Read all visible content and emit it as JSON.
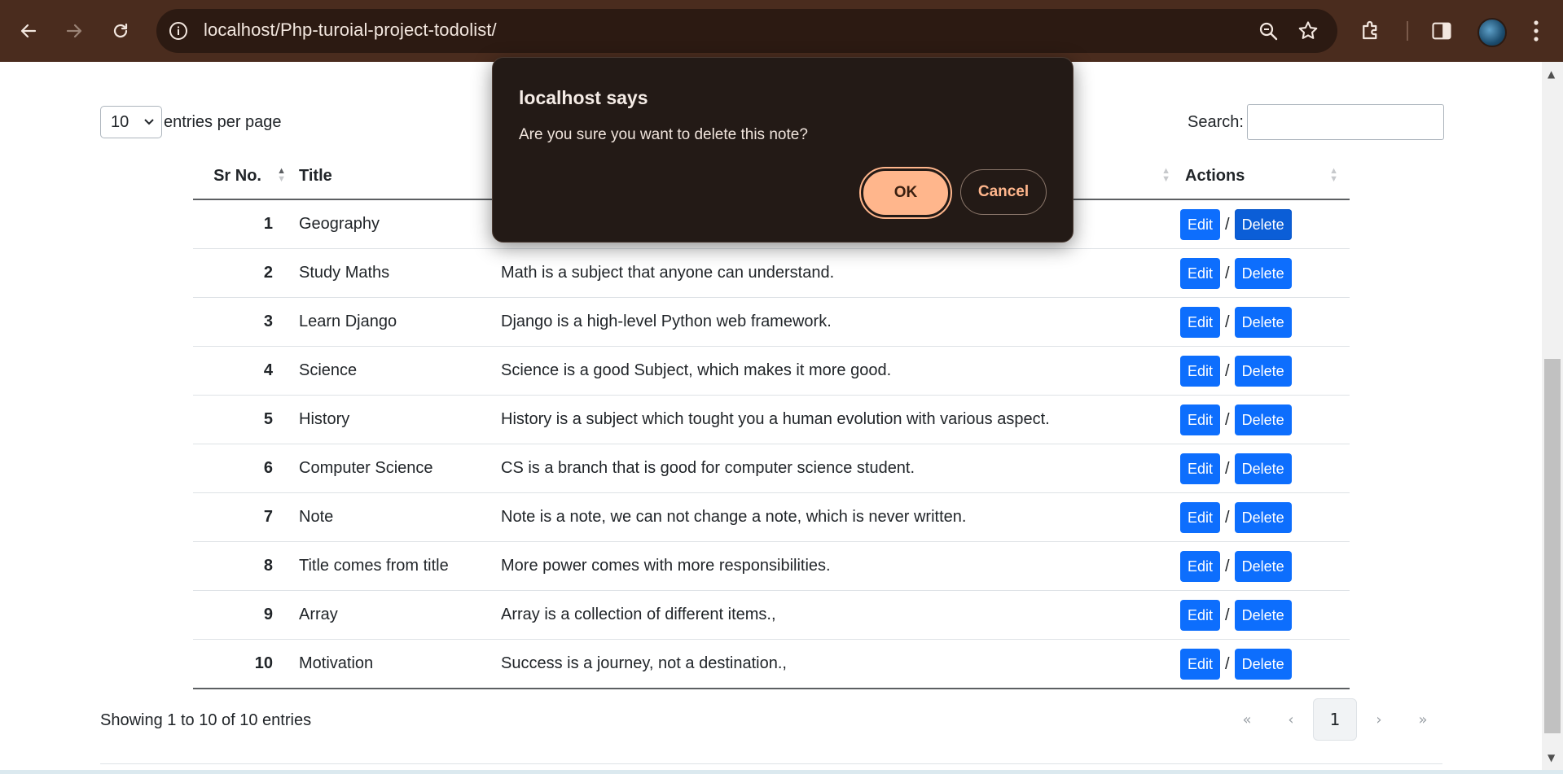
{
  "browser": {
    "url": "localhost/Php-turoial-project-todolist/"
  },
  "controls": {
    "entries_value": "10",
    "entries_label": "entries per page",
    "search_label": "Search:",
    "search_value": ""
  },
  "table": {
    "headers": [
      "Sr No.",
      "Title",
      "",
      "Actions"
    ],
    "rows": [
      {
        "sr": "1",
        "title": "Geography",
        "desc": ""
      },
      {
        "sr": "2",
        "title": "Study Maths",
        "desc": "Math is a subject that anyone can understand."
      },
      {
        "sr": "3",
        "title": "Learn Django",
        "desc": "Django is a high-level Python web framework."
      },
      {
        "sr": "4",
        "title": "Science",
        "desc": "Science is a good Subject, which makes it more good."
      },
      {
        "sr": "5",
        "title": "History",
        "desc": "History is a subject which tought you a human evolution with various aspect."
      },
      {
        "sr": "6",
        "title": "Computer Science",
        "desc": "CS is a branch that is good for computer science student."
      },
      {
        "sr": "7",
        "title": "Note",
        "desc": "Note is a note, we can not change a note, which is never written."
      },
      {
        "sr": "8",
        "title": "Title comes from title",
        "desc": "More power comes with more responsibilities."
      },
      {
        "sr": "9",
        "title": "Array",
        "desc": "Array is a collection of different items.,"
      },
      {
        "sr": "10",
        "title": "Motivation",
        "desc": "Success is a journey, not a destination.,"
      }
    ],
    "edit_label": "Edit",
    "delete_label": "Delete",
    "separator": "/"
  },
  "footer": {
    "info": "Showing 1 to 10 of 10 entries",
    "pagination": {
      "first": "«",
      "prev": "‹",
      "current": "1",
      "next": "›",
      "last": "»"
    }
  },
  "dialog": {
    "title": "localhost says",
    "message": "Are you sure you want to delete this note?",
    "ok_label": "OK",
    "cancel_label": "Cancel"
  },
  "colors": {
    "chrome_bg": "#4a2c1e",
    "primary_button": "#0d6efd",
    "dialog_bg": "#231a16",
    "dialog_accent": "#ffb68c"
  }
}
